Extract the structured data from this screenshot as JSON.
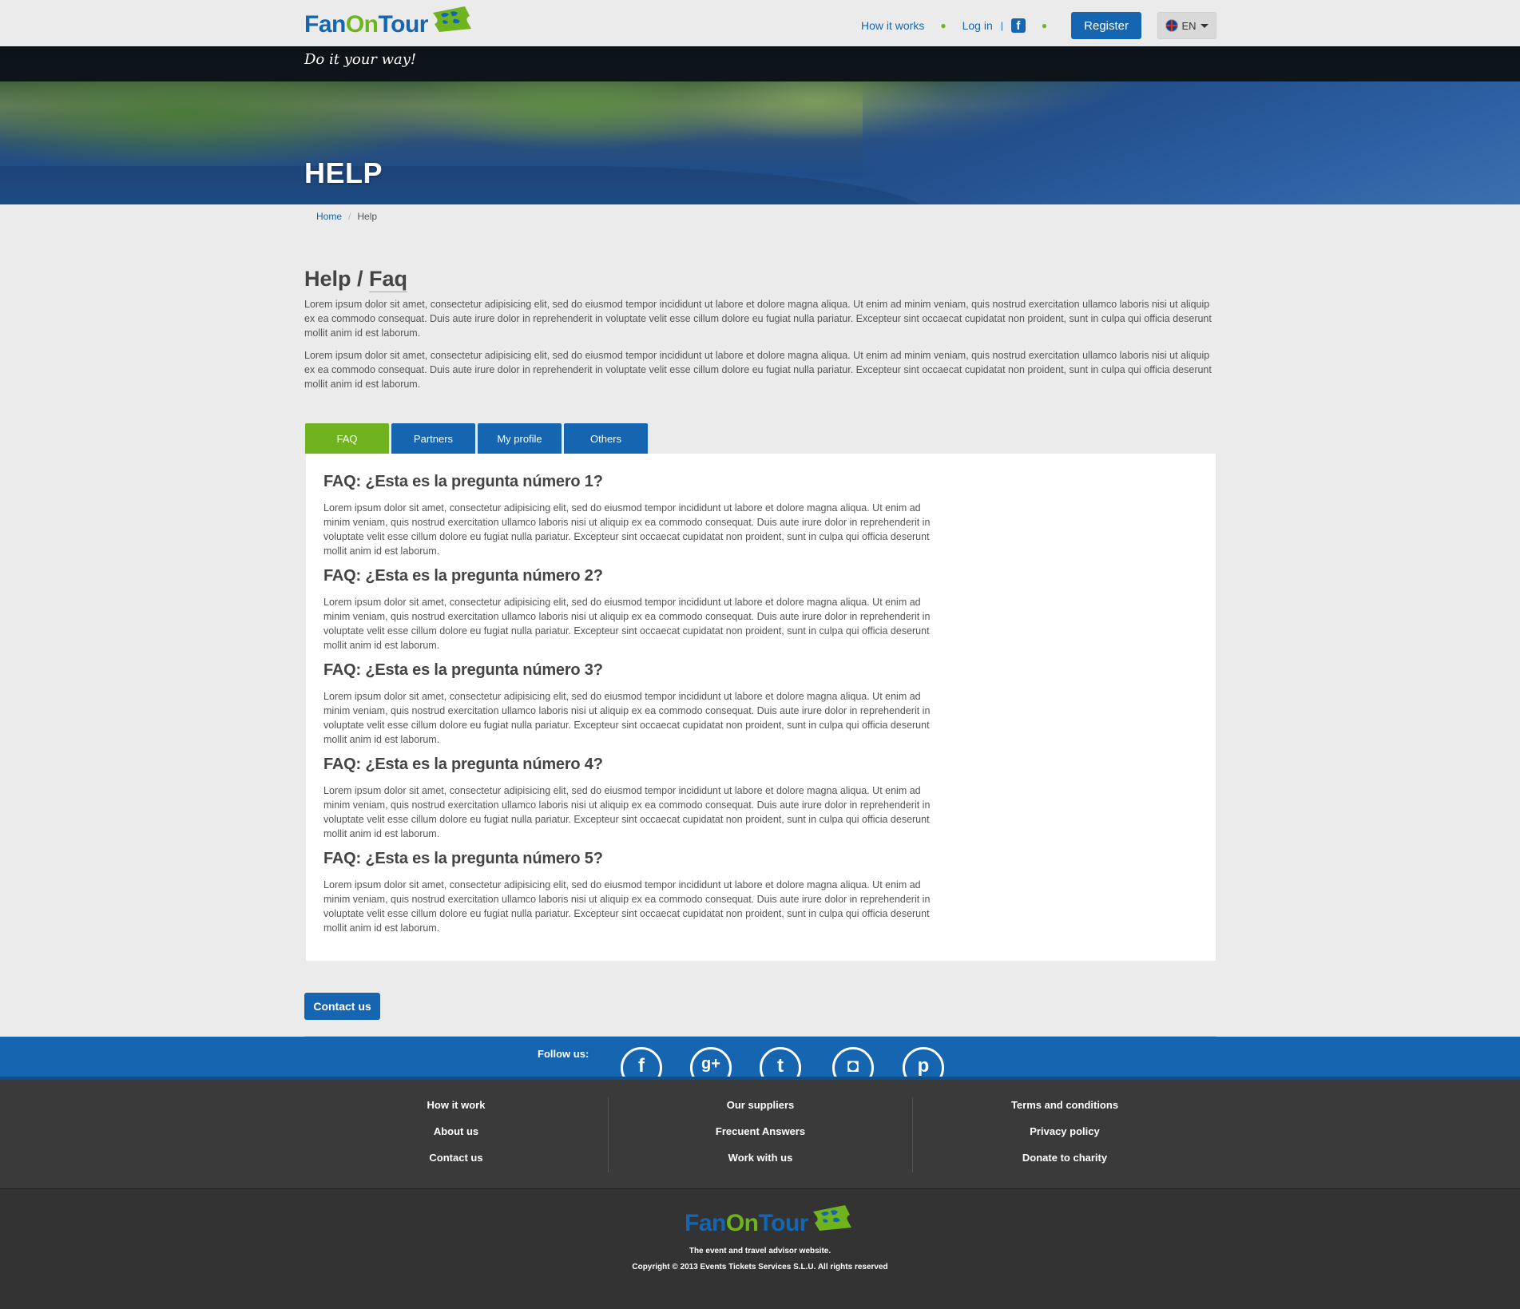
{
  "brand": {
    "logo_fan": "Fan",
    "logo_on": "On",
    "logo_tour": "Tour",
    "tagline": "Do it your way!",
    "colors": {
      "primary": "#1565b0",
      "accent": "#6fb41f"
    }
  },
  "header": {
    "nav": {
      "how_it_works": "How it works",
      "log_in": "Log in",
      "facebook_icon": "f",
      "register": "Register",
      "language": "EN"
    }
  },
  "hero": {
    "title": "HELP"
  },
  "breadcrumb": {
    "home": "Home",
    "current": "Help"
  },
  "intro": {
    "heading_part1": "Help / ",
    "heading_part2": "Faq",
    "paragraphs": [
      "Lorem ipsum dolor sit amet, consectetur adipisicing elit, sed do eiusmod tempor incididunt ut labore et dolore magna aliqua. Ut enim ad minim veniam, quis nostrud exercitation ullamco laboris nisi ut aliquip ex ea commodo consequat. Duis aute irure dolor in reprehenderit in voluptate velit esse cillum dolore eu fugiat nulla pariatur. Excepteur sint occaecat cupidatat non proident, sunt in culpa qui officia deserunt mollit anim id est laborum.",
      "Lorem ipsum dolor sit amet, consectetur adipisicing elit, sed do eiusmod tempor incididunt ut labore et dolore magna aliqua. Ut enim ad minim veniam, quis nostrud exercitation ullamco laboris nisi ut aliquip ex ea commodo consequat. Duis aute irure dolor in reprehenderit in voluptate velit esse cillum dolore eu fugiat nulla pariatur. Excepteur sint occaecat cupidatat non proident, sunt in culpa qui officia deserunt mollit anim id est laborum."
    ]
  },
  "tabs": [
    {
      "label": "FAQ",
      "active": true
    },
    {
      "label": "Partners",
      "active": false
    },
    {
      "label": "My profile",
      "active": false
    },
    {
      "label": "Others",
      "active": false
    }
  ],
  "faqs": [
    {
      "question": "FAQ: ¿Esta es la pregunta número 1?",
      "answer": "Lorem ipsum dolor sit amet, consectetur adipisicing elit, sed do eiusmod tempor incididunt ut labore et dolore magna aliqua. Ut enim ad minim veniam, quis nostrud exercitation ullamco laboris nisi ut aliquip ex ea commodo consequat. Duis aute irure dolor in reprehenderit in voluptate velit esse cillum dolore eu fugiat nulla pariatur. Excepteur sint occaecat cupidatat non proident, sunt in culpa qui officia deserunt mollit anim id est laborum."
    },
    {
      "question": "FAQ: ¿Esta es la pregunta número 2?",
      "answer": "Lorem ipsum dolor sit amet, consectetur adipisicing elit, sed do eiusmod tempor incididunt ut labore et dolore magna aliqua. Ut enim ad minim veniam, quis nostrud exercitation ullamco laboris nisi ut aliquip ex ea commodo consequat. Duis aute irure dolor in reprehenderit in voluptate velit esse cillum dolore eu fugiat nulla pariatur. Excepteur sint occaecat cupidatat non proident, sunt in culpa qui officia deserunt mollit anim id est laborum."
    },
    {
      "question": "FAQ: ¿Esta es la pregunta número 3?",
      "answer": "Lorem ipsum dolor sit amet, consectetur adipisicing elit, sed do eiusmod tempor incididunt ut labore et dolore magna aliqua. Ut enim ad minim veniam, quis nostrud exercitation ullamco laboris nisi ut aliquip ex ea commodo consequat. Duis aute irure dolor in reprehenderit in voluptate velit esse cillum dolore eu fugiat nulla pariatur. Excepteur sint occaecat cupidatat non proident, sunt in culpa qui officia deserunt mollit anim id est laborum."
    },
    {
      "question": "FAQ: ¿Esta es la pregunta número 4?",
      "answer": "Lorem ipsum dolor sit amet, consectetur adipisicing elit, sed do eiusmod tempor incididunt ut labore et dolore magna aliqua. Ut enim ad minim veniam, quis nostrud exercitation ullamco laboris nisi ut aliquip ex ea commodo consequat. Duis aute irure dolor in reprehenderit in voluptate velit esse cillum dolore eu fugiat nulla pariatur. Excepteur sint occaecat cupidatat non proident, sunt in culpa qui officia deserunt mollit anim id est laborum."
    },
    {
      "question": "FAQ: ¿Esta es la pregunta número 5?",
      "answer": "Lorem ipsum dolor sit amet, consectetur adipisicing elit, sed do eiusmod tempor incididunt ut labore et dolore magna aliqua. Ut enim ad minim veniam, quis nostrud exercitation ullamco laboris nisi ut aliquip ex ea commodo consequat. Duis aute irure dolor in reprehenderit in voluptate velit esse cillum dolore eu fugiat nulla pariatur. Excepteur sint occaecat cupidatat non proident, sunt in culpa qui officia deserunt mollit anim id est laborum."
    }
  ],
  "contact_button": "Contact us",
  "follow": {
    "label": "Follow us:",
    "icons": {
      "facebook": "f",
      "googleplus": "g+",
      "twitter": "t",
      "instagram": "◘",
      "pinterest": "p"
    }
  },
  "footer": {
    "col1": [
      "How it work",
      "About us",
      "Contact us"
    ],
    "col2": [
      "Our suppliers",
      "Frecuent Answers",
      "Work with us"
    ],
    "col3": [
      "Terms and conditions",
      "Privacy policy",
      "Donate to charity"
    ],
    "tagline": "The event and travel advisor website.",
    "copyright": "Copyright © 2013 Events Tickets Services S.L.U. All rights reserved"
  }
}
